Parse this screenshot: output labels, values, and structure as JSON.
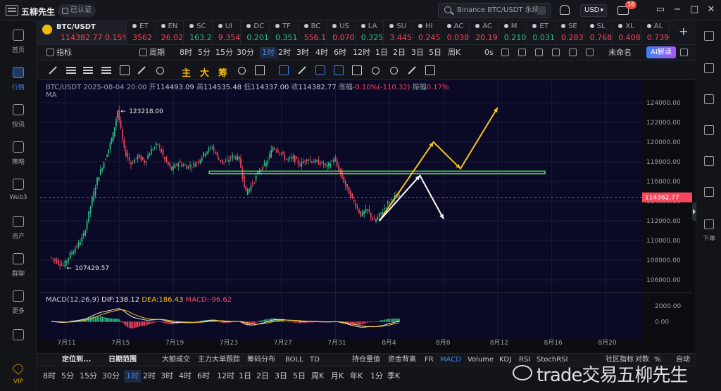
{
  "app": {
    "name": "五柳先生",
    "verified": "已认证"
  },
  "header": {
    "search_placeholder": "Binance BTC/USDT 永续",
    "currency": "USD",
    "mail_badge": "16"
  },
  "left_nav": [
    {
      "label": "首页",
      "icon": "home-icon"
    },
    {
      "label": "行情",
      "icon": "chart-bars-icon",
      "active": true
    },
    {
      "label": "快讯",
      "icon": "news-icon"
    },
    {
      "label": "策略",
      "icon": "robot-icon"
    },
    {
      "label": "Web3",
      "icon": "web3-icon"
    },
    {
      "label": "资产",
      "icon": "wallet-icon"
    },
    {
      "label": "群聊",
      "icon": "chat-icon"
    },
    {
      "label": "更多",
      "icon": "grid-icon"
    },
    {
      "label": "",
      "icon": "phone-icon"
    },
    {
      "label": "VIP",
      "icon": "vip-diamond-icon"
    }
  ],
  "right_nav": {
    "label": "下单"
  },
  "ticker": [
    {
      "sym": "BTC/USDT",
      "price": "114382.77",
      "change": "0.15%",
      "dir": "dn",
      "main": true
    },
    {
      "sym": "ET",
      "price": "3562",
      "dir": "dn"
    },
    {
      "sym": "EN",
      "price": "26.02",
      "dir": "dn"
    },
    {
      "sym": "SC",
      "price": "163.2",
      "dir": "up"
    },
    {
      "sym": "UI",
      "price": "9.354",
      "dir": "dn"
    },
    {
      "sym": "DC",
      "price": "0.201",
      "dir": "up"
    },
    {
      "sym": "TF",
      "price": "0.351",
      "dir": "up"
    },
    {
      "sym": "BC",
      "price": "556.1",
      "dir": "dn"
    },
    {
      "sym": "US",
      "price": "0.070",
      "dir": "dn"
    },
    {
      "sym": "LA",
      "price": "0.325",
      "dir": "up"
    },
    {
      "sym": "SU",
      "price": "3.445",
      "dir": "dn"
    },
    {
      "sym": "HI",
      "price": "0.245",
      "dir": "dn"
    },
    {
      "sym": "AC",
      "price": "0.038",
      "dir": "dn"
    },
    {
      "sym": "AC",
      "price": "20.19",
      "dir": "dn"
    },
    {
      "sym": "M",
      "price": "0.210",
      "dir": "up"
    },
    {
      "sym": "ET",
      "price": "0.031",
      "dir": "up"
    },
    {
      "sym": "SE",
      "price": "0.283",
      "dir": "dn"
    },
    {
      "sym": "SL",
      "price": "0.768",
      "dir": "dn"
    },
    {
      "sym": "XL",
      "price": "0.408",
      "dir": "dn"
    },
    {
      "sym": "AL",
      "price": "0.739",
      "dir": "dn"
    }
  ],
  "toolbar": {
    "indicators": "指标",
    "period": "周期",
    "timeframes": [
      "8时",
      "5分",
      "15分",
      "30分",
      "1时",
      "2时",
      "3时",
      "4时",
      "6时",
      "12时",
      "1日",
      "2日",
      "3日",
      "5日",
      "周K"
    ],
    "active_tf": "1时",
    "countdown": "0s",
    "unnamed": "未命名",
    "ai": "AI解读"
  },
  "drawtools": {
    "main": "主",
    "big": "大",
    "chip": "筹"
  },
  "chart_info": {
    "pair": "BTC/USDT",
    "datetime": "2025-08-04 20:00",
    "open_label": "开",
    "open": "114493.09",
    "high_label": "高",
    "high": "114535.48",
    "low_label": "低",
    "low": "114337.00",
    "close_label": "收",
    "close": "114382.77",
    "change_label": "涨幅",
    "change": "-0.10%(-110.32)",
    "amp_label": "振幅",
    "amp": "0.17%",
    "ma": "MA",
    "macd_label": "MACD(12,26,9)",
    "dif": "DIF:138.12",
    "dea": "DEA:186.43",
    "macd": "MACD:-96.62"
  },
  "chart_data": {
    "type": "line",
    "x": [
      "2025-07-10 00:00",
      "2025-07-10 12:00",
      "2025-07-11 00:00",
      "2025-07-11 12:00",
      "2025-07-12 00:00",
      "2025-07-12 12:00",
      "2025-07-13 00:00",
      "2025-07-13 12:00",
      "2025-07-14 00:00",
      "2025-07-14 08:00",
      "2025-07-14 16:00",
      "2025-07-15 00:00",
      "2025-07-15 12:00",
      "2025-07-16 00:00",
      "2025-07-16 12:00",
      "2025-07-17 00:00",
      "2025-07-17 12:00",
      "2025-07-18 00:00",
      "2025-07-18 12:00",
      "2025-07-19 00:00",
      "2025-07-19 12:00",
      "2025-07-20 00:00",
      "2025-07-20 12:00",
      "2025-07-21 00:00",
      "2025-07-21 12:00",
      "2025-07-22 00:00",
      "2025-07-22 12:00",
      "2025-07-23 00:00",
      "2025-07-23 12:00",
      "2025-07-24 00:00",
      "2025-07-24 12:00",
      "2025-07-25 00:00",
      "2025-07-25 12:00",
      "2025-07-26 00:00",
      "2025-07-26 12:00",
      "2025-07-27 00:00",
      "2025-07-27 12:00",
      "2025-07-28 00:00",
      "2025-07-28 12:00",
      "2025-07-29 00:00",
      "2025-07-29 12:00",
      "2025-07-30 00:00",
      "2025-07-30 12:00",
      "2025-07-31 00:00",
      "2025-07-31 12:00",
      "2025-08-01 00:00",
      "2025-08-01 12:00",
      "2025-08-02 00:00",
      "2025-08-02 12:00",
      "2025-08-03 00:00",
      "2025-08-03 12:00",
      "2025-08-04 00:00",
      "2025-08-04 12:00",
      "2025-08-04 20:00"
    ],
    "series": [
      {
        "values": [
          108300,
          107900,
          107429,
          108600,
          109400,
          110500,
          113500,
          116200,
          118000,
          119300,
          120800,
          123218,
          119200,
          117800,
          118600,
          118000,
          119200,
          119800,
          118200,
          117200,
          117900,
          117500,
          117600,
          118100,
          119000,
          119500,
          118200,
          117900,
          118600,
          118300,
          114800,
          115800,
          117100,
          117800,
          119500,
          119000,
          118200,
          118400,
          117700,
          118300,
          118000,
          117900,
          117500,
          118300,
          116800,
          115200,
          113900,
          112600,
          113100,
          111900,
          112800,
          113800,
          114500,
          114382.77
        ]
      }
    ],
    "ylim": [
      105000,
      125000
    ],
    "y_ticks": [
      "124000.00",
      "122000.00",
      "120000.00",
      "118000.00",
      "116000.00",
      "114000.00",
      "112000.00",
      "110000.00",
      "108000.00",
      "106000.00"
    ],
    "x_ticks": [
      "7月11",
      "7月15",
      "7月19",
      "7月23",
      "7月27",
      "7月31",
      "8月4",
      "8月8",
      "8月12",
      "8月16",
      "8月20"
    ],
    "annotations": [
      {
        "text": "123218.00"
      },
      {
        "text": "107429.57"
      }
    ],
    "support_line": 116900,
    "macd": {
      "ylim": [
        -1500,
        2800
      ],
      "y_ticks": [
        "2000.00",
        "0.00"
      ]
    },
    "colors": {
      "up": "#2ebd85",
      "down": "#f6465d",
      "support": "#4cd964",
      "yellow": "#f5c518",
      "white": "#ffffff",
      "bg": "#0b0a26"
    }
  },
  "indicator_bar": {
    "locate": "定位到...",
    "range": "日期范围",
    "items": [
      "大额成交",
      "主力大单跟踪",
      "筹码分布",
      "BOLL",
      "TD"
    ],
    "items2": [
      "持仓量值",
      "资金背离",
      "FR",
      "MACD",
      "Volume",
      "KDJ",
      "RSI",
      "StochRSI"
    ],
    "active": "MACD",
    "right": [
      "社区指标",
      "对数",
      "%",
      "自动"
    ]
  },
  "bottom_tf": {
    "items": [
      "8时",
      "5分",
      "15分",
      "30分",
      "1时",
      "2时",
      "3时",
      "4时",
      "6时",
      "12时",
      "1日",
      "2日",
      "3日",
      "5日",
      "周K",
      "月K",
      "年K",
      "1分",
      "季K"
    ],
    "active": "1时"
  },
  "watermark": "trade交易五柳先生"
}
